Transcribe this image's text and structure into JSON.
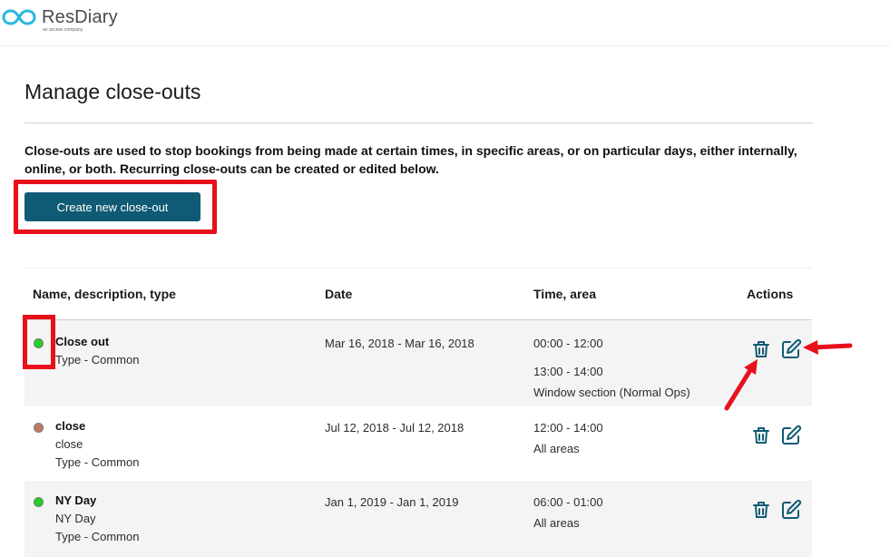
{
  "header": {
    "brand_name": "ResDiary",
    "brand_tagline": "an access company"
  },
  "page": {
    "title": "Manage close-outs",
    "description": "Close-outs are used to stop bookings from being made at certain times, in specific areas, or on particular days, either internally, online, or both. Recurring close-outs can be created or edited below.",
    "create_button_label": "Create new close-out"
  },
  "table": {
    "headers": {
      "name": "Name, description, type",
      "date": "Date",
      "time": "Time, area",
      "actions": "Actions"
    },
    "rows": [
      {
        "status_color": "#23d023",
        "name": "Close out",
        "type": "Type - Common",
        "date": "Mar 16, 2018 - Mar 16, 2018",
        "time1": "00:00 - 12:00",
        "time2": "13:00 - 14:00",
        "area": "Window section (Normal Ops)"
      },
      {
        "status_color": "#c07a64",
        "name": "close",
        "description": "close",
        "type": "Type - Common",
        "date": "Jul 12, 2018 - Jul 12, 2018",
        "time1": "12:00 - 14:00",
        "area": "All areas"
      },
      {
        "status_color": "#23d023",
        "name": "NY Day",
        "description": "NY Day",
        "type": "Type - Common",
        "date": "Jan 1, 2019 - Jan 1, 2019",
        "time1": "06:00 - 01:00",
        "area": "All areas"
      }
    ]
  },
  "icons": {
    "delete": "trash-icon",
    "edit": "edit-icon"
  },
  "colors": {
    "primary": "#0f5a74",
    "annotation": "#e8101a",
    "icon": "#0f5a74"
  }
}
